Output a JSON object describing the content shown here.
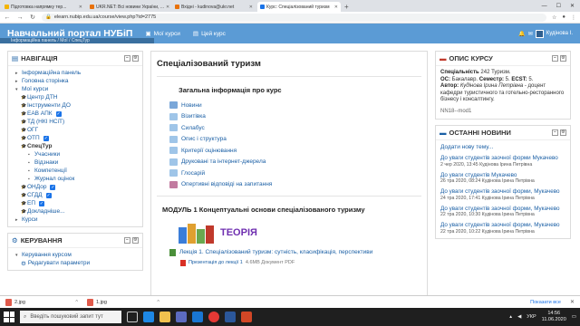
{
  "browser": {
    "tabs": [
      {
        "label": "Підготовка напрямку тер...",
        "fav_color": "#f4b400",
        "active": false
      },
      {
        "label": "UKR.NET: Всі новини України, ...",
        "fav_color": "#e8710a",
        "active": false
      },
      {
        "label": "Вхідні - kudinova@ukr.net",
        "fav_color": "#e8710a",
        "active": false
      },
      {
        "label": "Курс: Спеціалізований туризм",
        "fav_color": "#1a73e8",
        "active": true
      }
    ],
    "url": "elearn.nubip.edu.ua/course/view.php?id=2775",
    "new_tab": "+"
  },
  "header": {
    "site_name": "Навчальний портал НУБіП",
    "menu_courses": "Мої курси",
    "menu_this_course": "Цей курс",
    "user_name": "Кудінова І.",
    "breadcrumb": "Інформаційна панель  /  Мої  /  СпецТур"
  },
  "nav_block": {
    "title": "НАВІГАЦІЯ",
    "items": [
      {
        "label": "Інформаційна панель",
        "level": 1
      },
      {
        "label": "Головна сторінка",
        "level": 1
      },
      {
        "label": "Мої курси",
        "level": 1
      },
      {
        "label": "Центр ДТН",
        "level": 2,
        "checked": false
      },
      {
        "label": "Інструменти ДО",
        "level": 2,
        "checked": false
      },
      {
        "label": "ЕАВ АПК",
        "level": 2,
        "checked": true
      },
      {
        "label": "ТД (НКІ НСіТ)",
        "level": 2,
        "checked": false
      },
      {
        "label": "ОГГ",
        "level": 2,
        "checked": false
      },
      {
        "label": "ОТП",
        "level": 2,
        "checked": true
      },
      {
        "label": "СпецТур",
        "level": 2,
        "checked": false,
        "current": true
      },
      {
        "label": "Учасники",
        "level": 3
      },
      {
        "label": "Відзнаки",
        "level": 3
      },
      {
        "label": "Компетенції",
        "level": 3
      },
      {
        "label": "Журнал оцінок",
        "level": 3
      },
      {
        "label": "ОНДор",
        "level": 2,
        "checked": true
      },
      {
        "label": "СГДД",
        "level": 2,
        "checked": true
      },
      {
        "label": "ЕП",
        "level": 2,
        "checked": true
      },
      {
        "label": "Докладніше...",
        "level": 2,
        "checked": false
      },
      {
        "label": "Курси",
        "level": 1
      }
    ]
  },
  "admin_block": {
    "title": "КЕРУВАННЯ",
    "items": [
      {
        "label": "Керування курсом"
      },
      {
        "label": "Редагувати параметри"
      }
    ]
  },
  "main": {
    "course_title": "Спеціалізований туризм",
    "general_title": "Загальна інформація про курс",
    "resources": [
      {
        "label": "Новини",
        "color": "#7aa7d9"
      },
      {
        "label": "Візитівка",
        "color": "#9fc5e8"
      },
      {
        "label": "Силабус",
        "color": "#9fc5e8"
      },
      {
        "label": "Опис і структура",
        "color": "#9fc5e8"
      },
      {
        "label": "Критерії оцінювання",
        "color": "#9fc5e8"
      },
      {
        "label": "Друковані та інтернет-джерела",
        "color": "#9fc5e8"
      },
      {
        "label": "Глосарій",
        "color": "#9fc5e8"
      },
      {
        "label": "Опертивні відповіді на запитання",
        "color": "#c27ba0"
      }
    ],
    "module_title": "МОДУЛЬ 1 Концептуальні основи спеціалізованого туризму",
    "theory_label": "ТЕОРІЯ",
    "lecture": "Лекція 1. Спеціалізований туризм: сутність, класифікація, перспективи",
    "presentation": "Презентація до лекції 1",
    "presentation_meta": "4.6MB Документ PDF"
  },
  "desc_block": {
    "title": "ОПИС КУРСУ",
    "specialty_label": "Спеціальність",
    "specialty_value": "242 Туризм.",
    "os_label": "ОС:",
    "os_value": "Бакалавр.",
    "semester_label": "Семестр:",
    "semester_value": "5.",
    "ects_label": "ECST:",
    "ects_value": "5.",
    "author_label": "Автор:",
    "author_value": "Кудінова Ірина Петрівна",
    "author_rest": "- доцент кафедри туристичного та готельно-ресторанного бізнесу і консалтингу.",
    "code": "NN18--mod1"
  },
  "news_block": {
    "title": "ОСТАННІ НОВИНИ",
    "add_label": "Додати нову тему...",
    "items": [
      {
        "title": "До уваги студентів заочної форми Мукачево",
        "meta": "2 чер 2020, 13:45  Кудінова Ірина Петрівна"
      },
      {
        "title": "До уваги студентів Мукачево",
        "meta": "26 тра 2020, 08:24  Кудінова Ірина Петрівна"
      },
      {
        "title": "До уваги студентів заочної форми, Мукачево",
        "meta": "24 тра 2020, 17:41  Кудінова Ірина Петрівна"
      },
      {
        "title": "До уваги студентів заочної форми, Мукачево",
        "meta": "22 тра 2020, 10:30  Кудінова Ірина Петрівна"
      },
      {
        "title": "До уваги студентів заочної форми, Мукачево",
        "meta": "22 тра 2020, 10:22  Кудінова Ірина Петрівна"
      }
    ]
  },
  "downloads": {
    "files": [
      "2.jpg",
      "1.jpg"
    ],
    "show_all": "Показати все"
  },
  "taskbar": {
    "search_placeholder": "Введіть пошуковий запит тут",
    "lang": "УКР",
    "time": "14:56",
    "date": "11.06.2020"
  }
}
